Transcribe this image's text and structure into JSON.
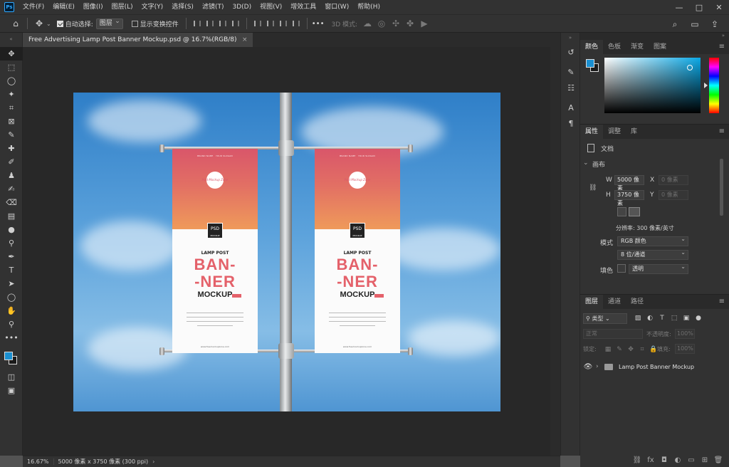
{
  "app": {
    "logo": "Ps"
  },
  "menu": [
    "文件(F)",
    "编辑(E)",
    "图像(I)",
    "图层(L)",
    "文字(Y)",
    "选择(S)",
    "滤镜(T)",
    "3D(D)",
    "视图(V)",
    "增效工具",
    "窗口(W)",
    "帮助(H)"
  ],
  "window_controls": {
    "minimize": "—",
    "maximize": "□",
    "close": "✕"
  },
  "options": {
    "auto_select_label": "自动选择:",
    "auto_select_value": "图层",
    "show_transform_label": "显示变换控件",
    "more": "•••",
    "mode_3d_label": "3D 模式:"
  },
  "document": {
    "tab_title": "Free Advertising Lamp Post Banner Mockup.psd @ 16.7%(RGB/8)",
    "close": "×"
  },
  "banner": {
    "top_small": "BRAND NAME &nbsp; YOUR SLOGAN",
    "logo_text": "Post Mockup Zone",
    "psd_label": "PSD",
    "psd_sub": "MOCKUP",
    "lamp_post": "LAMP POST",
    "ban_line1": "BAN-",
    "ban_line2": "-NER",
    "mockup": "MOCKUP",
    "url": "www.freemockupzone.com"
  },
  "panels": {
    "color_tabs": [
      "颜色",
      "色板",
      "渐变",
      "图案"
    ],
    "color_fg": "#1a8fd0",
    "color_bg": "#1a1a1a",
    "props_tabs": [
      "属性",
      "调整",
      "库"
    ],
    "doc_label": "文档",
    "canvas_section": "画布",
    "w_label": "W",
    "w_value": "5000 像素",
    "x_label": "X",
    "x_placeholder": "0 像素",
    "h_label": "H",
    "h_value": "3750 像素",
    "y_label": "Y",
    "y_placeholder": "0 像素",
    "resolution": "分辨率: 300 像素/英寸",
    "mode_label": "模式",
    "mode_value": "RGB 颜色",
    "depth_value": "8 位/通道",
    "fill_label": "填色",
    "fill_value": "透明",
    "layers_tabs": [
      "图层",
      "通道",
      "路径"
    ],
    "kind_filter": "类型",
    "blend_mode": "正常",
    "opacity_label": "不透明度:",
    "opacity_value": "100%",
    "lock_label": "锁定:",
    "fill2_label": "填充:",
    "fill2_value": "100%",
    "layer_name": "Lamp Post Banner Mockup"
  },
  "status": {
    "zoom": "16.67%",
    "doc_info": "5000 像素 x 3750 像素 (300 ppi)",
    "arrow": "›"
  }
}
